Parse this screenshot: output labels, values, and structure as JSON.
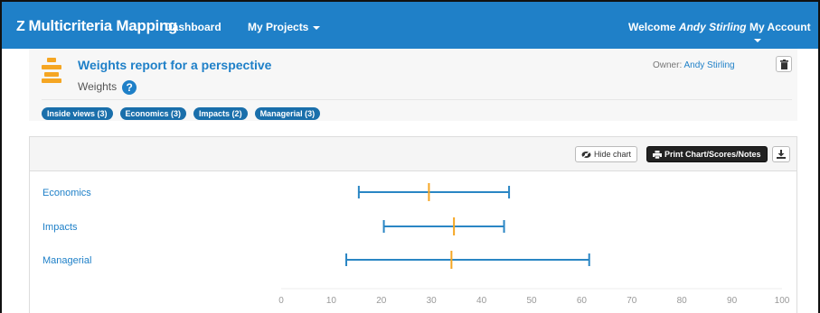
{
  "navbar": {
    "brand": "Multicriteria Mapping",
    "brand_mark": "Z",
    "links": [
      "Dashboard",
      "My Projects"
    ],
    "welcome_prefix": "Welcome",
    "welcome_name": "Andy Stirling",
    "account": "My Account"
  },
  "report": {
    "title": "Weights report for a perspective",
    "subtitle": "Weights",
    "help": "?",
    "owner_label": "Owner:",
    "owner_name": "Andy Stirling",
    "chips": [
      "Inside views (3)",
      "Economics (3)",
      "Impacts (2)",
      "Managerial (3)"
    ]
  },
  "toolbar": {
    "hide_chart": "Hide chart",
    "print": "Print Chart/Scores/Notes"
  },
  "colors": {
    "accent": "#1f80c8",
    "range_line": "#2a86c4",
    "median_tick": "#f5a623"
  },
  "chart_data": {
    "type": "range",
    "categories": [
      "Economics",
      "Impacts",
      "Managerial"
    ],
    "series": [
      {
        "min": 15.5,
        "median": 29.5,
        "max": 45.5
      },
      {
        "min": 20.5,
        "median": 34.5,
        "max": 44.5
      },
      {
        "min": 13,
        "median": 34,
        "max": 61.5
      }
    ],
    "xlim": [
      0,
      100
    ],
    "xticks": [
      0,
      10,
      20,
      30,
      40,
      50,
      60,
      70,
      80,
      90,
      100
    ]
  }
}
